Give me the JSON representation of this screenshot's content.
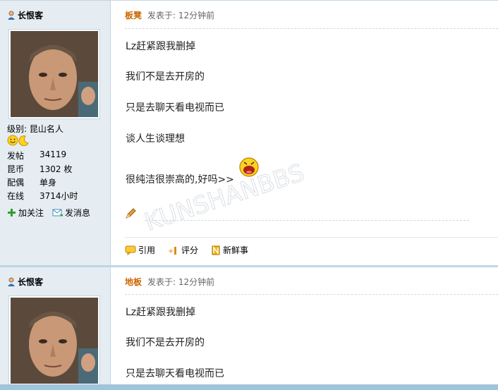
{
  "posts": [
    {
      "author": "长恨客",
      "level_label": "级别: 昆山名人",
      "stats": [
        {
          "key": "发帖",
          "value": "34119"
        },
        {
          "key": "昆币",
          "value": "1302 枚"
        },
        {
          "key": "配偶",
          "value": "单身"
        },
        {
          "key": "在线",
          "value": "3714小时"
        }
      ],
      "follow_label": "加关注",
      "message_label": "发消息",
      "floor": "板凳",
      "posted": "发表于: 12分钟前",
      "lines": [
        "Lz赶紧跟我删掉",
        "我们不是去开房的",
        "只是去聊天看电视而已",
        "谈人生谈理想",
        "很纯洁很崇高的,好吗>>"
      ],
      "tools": {
        "quote": "引用",
        "rate": "评分",
        "fresh": "新鲜事"
      }
    },
    {
      "author": "长恨客",
      "floor": "地板",
      "posted": "发表于: 12分钟前",
      "lines": [
        "Lz赶紧跟我删掉",
        "我们不是去开房的",
        "只是去聊天看电视而已"
      ]
    }
  ],
  "watermark": "KUNSHANBBS",
  "icons": [
    "user-icon",
    "smile-medal-icon",
    "moon-medal-icon",
    "plus-icon",
    "message-icon",
    "laugh-emoji-icon",
    "pencil-icon",
    "quote-icon",
    "rate-icon",
    "fresh-icon"
  ],
  "colors": {
    "sidebar_bg": "#e5edf2",
    "border": "#c2d5e3",
    "floor": "#cc6600"
  }
}
